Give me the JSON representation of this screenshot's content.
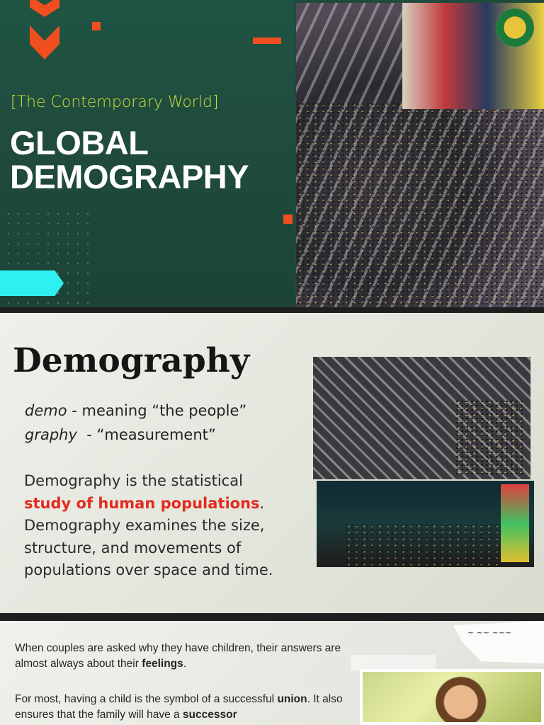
{
  "slide1": {
    "subtitle": "[The Contemporary World]",
    "title_line1": "GLOBAL",
    "title_line2": "DEMOGRAPHY"
  },
  "slide2": {
    "heading": "Demography",
    "def1_term": "demo",
    "def1_text": " - meaning “the people”",
    "def2_term": "graphy",
    "def2_text": "  - “measurement”",
    "para_before": "Demography is the statistical ",
    "para_highlight": "study of human populations",
    "para_after": ". Demography examines the size, structure, and movements of populations over space and time."
  },
  "slide3": {
    "p1_a": "When couples are asked why they have children, their answers are almost always about their ",
    "p1_b": "feelings",
    "p1_c": ".",
    "p2_a": "For most, having a child is the symbol of a successful ",
    "p2_b": "union",
    "p2_c": ". It also ensures that the family will have a ",
    "p2_d": "successor"
  },
  "colors": {
    "green": "#1f4a3c",
    "orange": "#f04e1e",
    "cyan": "#2ef0f0",
    "lime": "#c9e23a",
    "red": "#e32b1f"
  }
}
